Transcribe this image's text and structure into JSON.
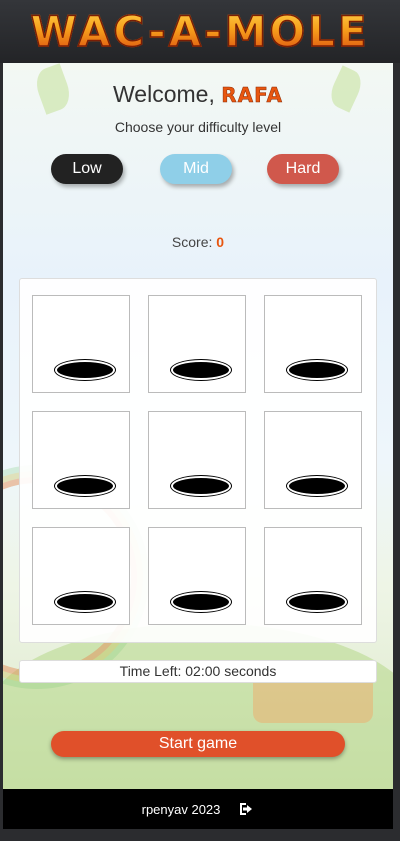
{
  "header": {
    "logo_text": "WAC-A-MOLE"
  },
  "welcome": {
    "prefix": "Welcome,",
    "name": "RAFA"
  },
  "difficulty": {
    "prompt": "Choose your difficulty level",
    "options": [
      "Low",
      "Mid",
      "Hard"
    ]
  },
  "score": {
    "label": "Score:",
    "value": "0"
  },
  "board": {
    "holes": 9
  },
  "timer": {
    "text": "Time Left: 02:00 seconds"
  },
  "actions": {
    "start_label": "Start game"
  },
  "footer": {
    "credit": "rpenyav 2023",
    "logout_icon": "logout-icon"
  },
  "colors": {
    "accent": "#e0502a",
    "low": "#222222",
    "mid": "#8fcfe8",
    "hard": "#d0584c"
  }
}
